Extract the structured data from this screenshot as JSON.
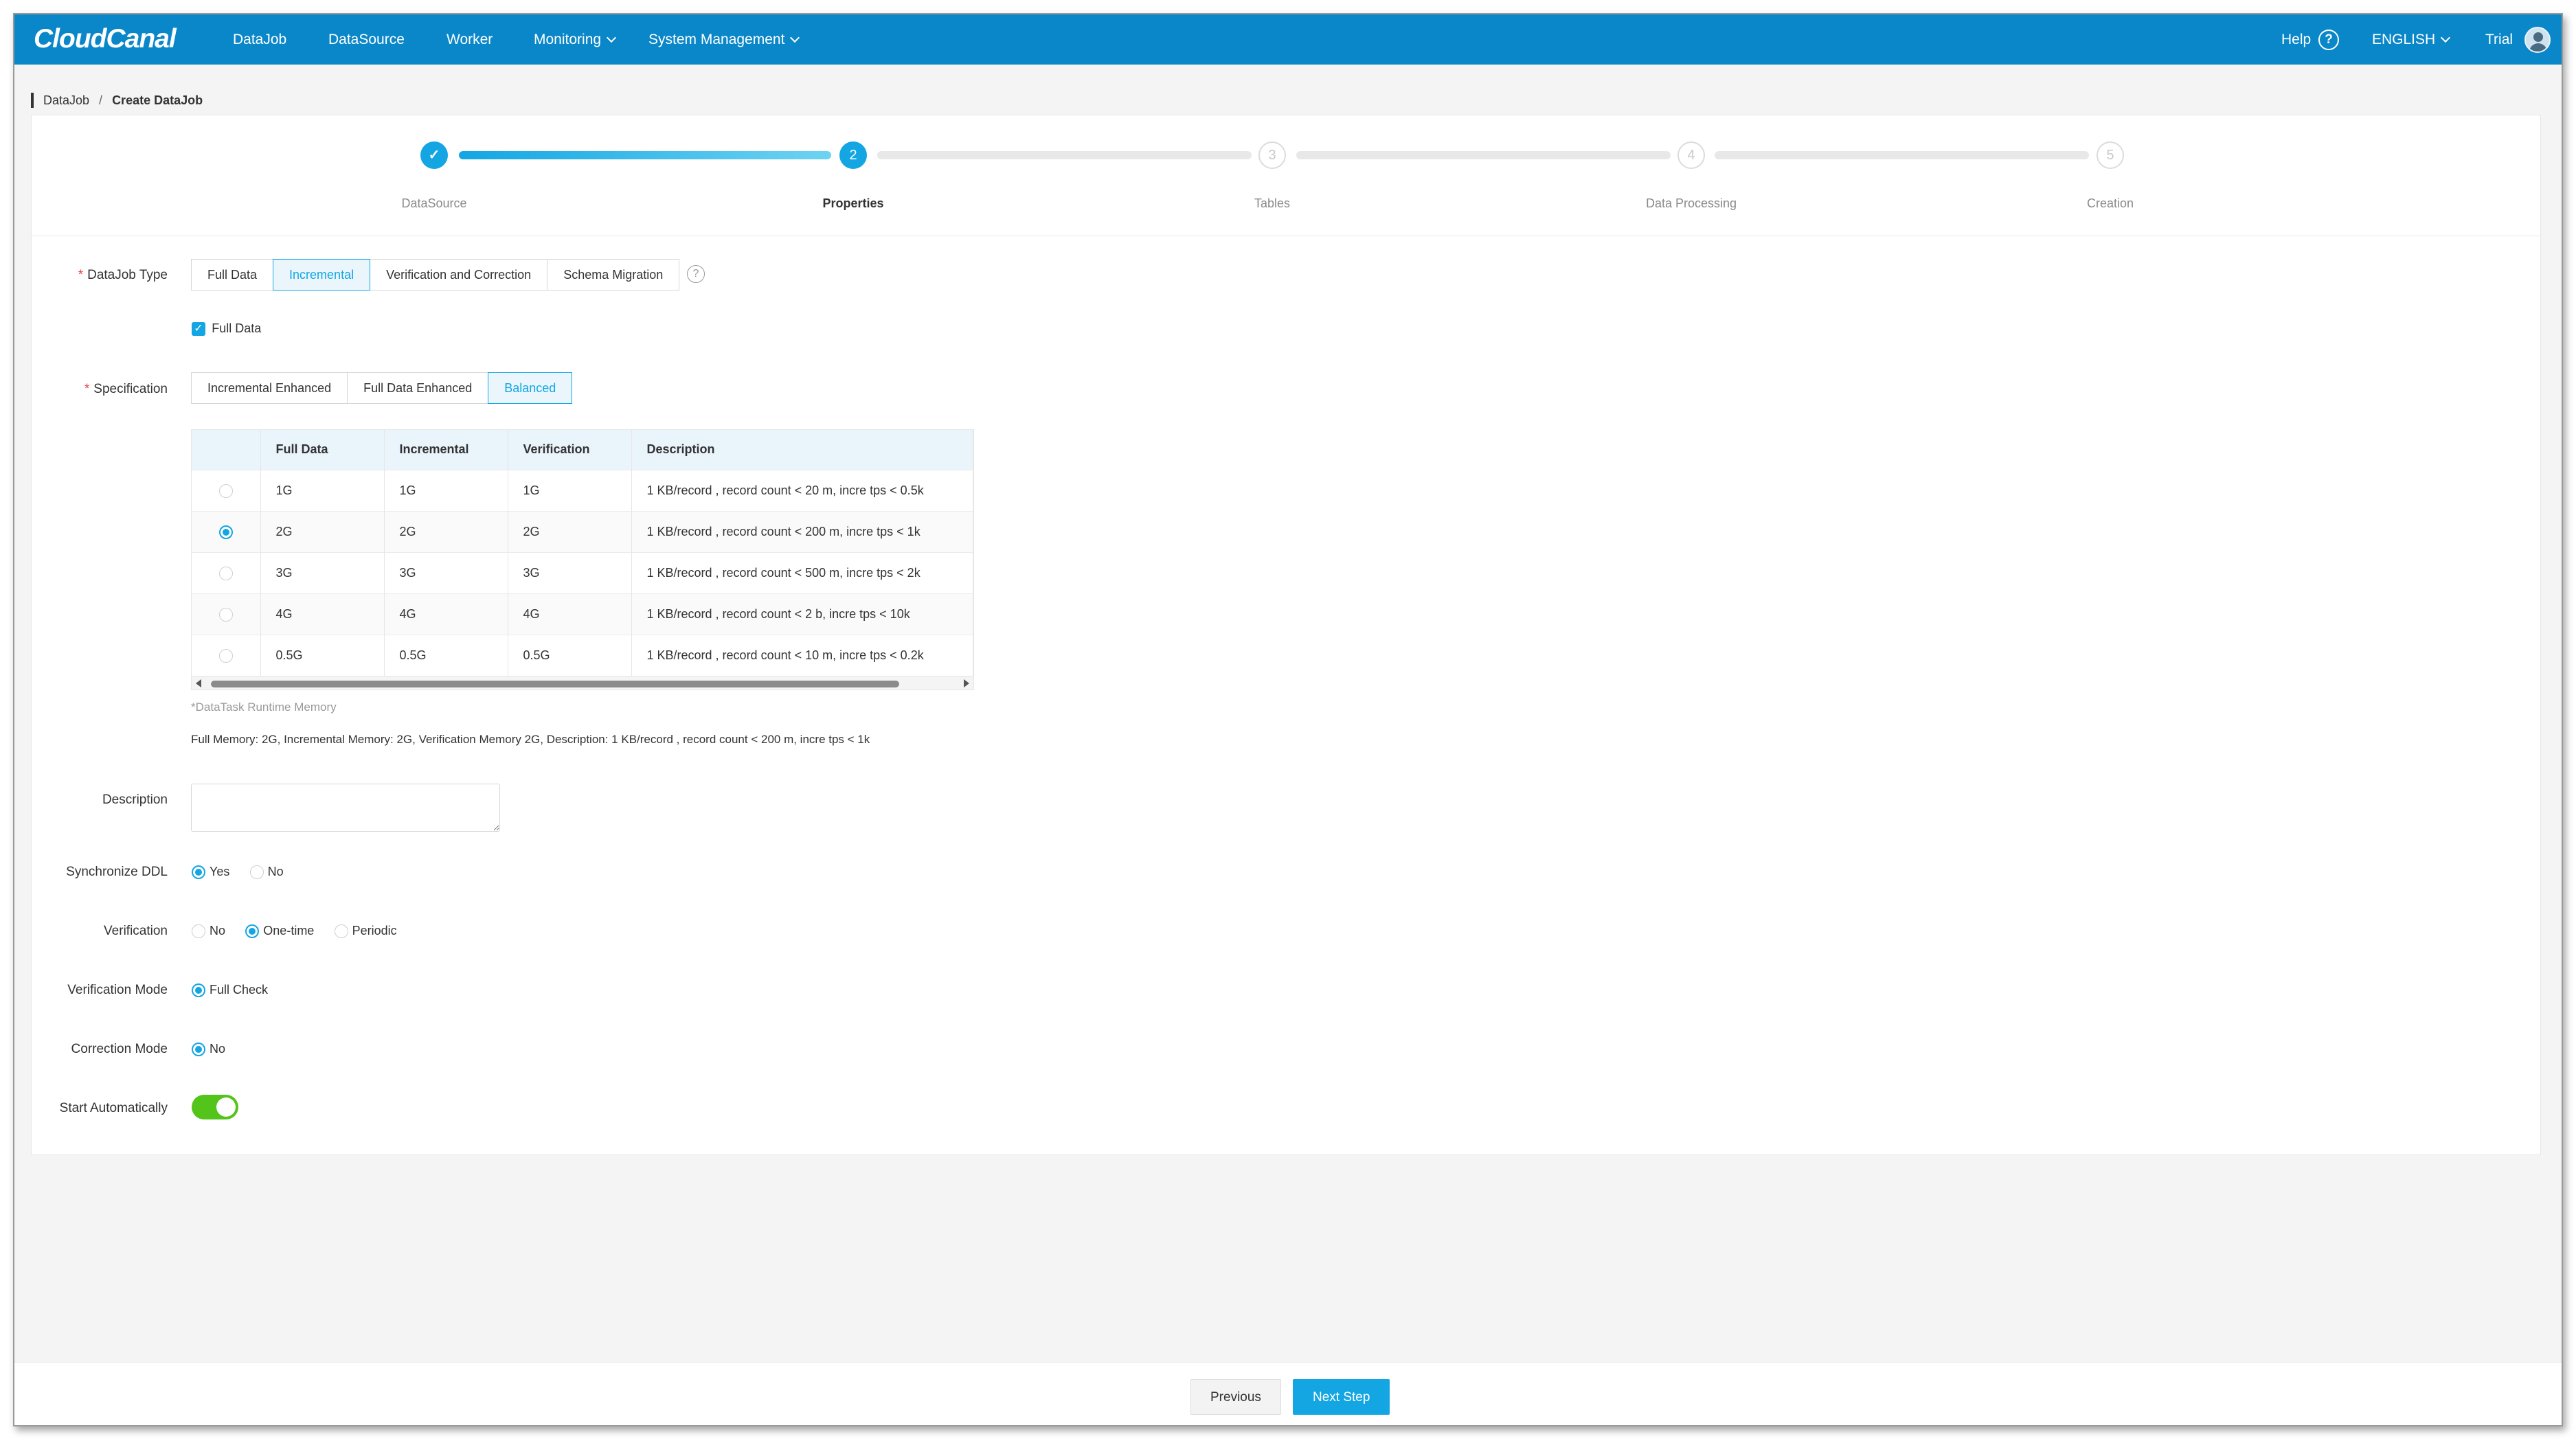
{
  "nav": {
    "logo": "CloudCanal",
    "items": [
      "DataJob",
      "DataSource",
      "Worker",
      "Monitoring",
      "System Management"
    ],
    "help": "Help",
    "help_icon": "?",
    "language": "ENGLISH",
    "user": "Trial"
  },
  "breadcrumb": {
    "parent": "DataJob",
    "separator": "/",
    "current": "Create DataJob"
  },
  "steps": [
    {
      "num": "✓",
      "label": "DataSource",
      "state": "done"
    },
    {
      "num": "2",
      "label": "Properties",
      "state": "active"
    },
    {
      "num": "3",
      "label": "Tables",
      "state": "todo"
    },
    {
      "num": "4",
      "label": "Data Processing",
      "state": "todo"
    },
    {
      "num": "5",
      "label": "Creation",
      "state": "todo"
    }
  ],
  "form": {
    "datajob_type": {
      "required_mark": "*",
      "label": "DataJob Type",
      "options": [
        "Full Data",
        "Incremental",
        "Verification and Correction",
        "Schema Migration"
      ],
      "selected": "Incremental",
      "info_icon": "?"
    },
    "full_data_checkbox": {
      "label": "Full Data",
      "checked": true
    },
    "specification": {
      "required_mark": "*",
      "label": "Specification",
      "options": [
        "Incremental Enhanced",
        "Full Data Enhanced",
        "Balanced"
      ],
      "selected": "Balanced",
      "table": {
        "columns": [
          "",
          "Full Data",
          "Incremental",
          "Verification",
          "Description"
        ],
        "rows": [
          {
            "full": "1G",
            "incr": "1G",
            "verif": "1G",
            "desc": "1 KB/record , record count < 20 m, incre tps < 0.5k",
            "selected": false
          },
          {
            "full": "2G",
            "incr": "2G",
            "verif": "2G",
            "desc": "1 KB/record , record count < 200 m, incre tps < 1k",
            "selected": true
          },
          {
            "full": "3G",
            "incr": "3G",
            "verif": "3G",
            "desc": "1 KB/record , record count < 500 m, incre tps < 2k",
            "selected": false
          },
          {
            "full": "4G",
            "incr": "4G",
            "verif": "4G",
            "desc": "1 KB/record , record count < 2 b, incre tps < 10k",
            "selected": false
          },
          {
            "full": "0.5G",
            "incr": "0.5G",
            "verif": "0.5G",
            "desc": "1 KB/record , record count < 10 m, incre tps < 0.2k",
            "selected": false
          }
        ]
      },
      "note": "*DataTask Runtime Memory",
      "summary": "Full Memory: 2G, Incremental Memory: 2G, Verification Memory 2G, Description: 1 KB/record , record count < 200 m, incre tps < 1k"
    },
    "description": {
      "label": "Description",
      "value": "",
      "placeholder": ""
    },
    "sync_ddl": {
      "label": "Synchronize DDL",
      "options": [
        "Yes",
        "No"
      ],
      "selected": "Yes"
    },
    "verification": {
      "label": "Verification",
      "options": [
        "No",
        "One-time",
        "Periodic"
      ],
      "selected": "One-time"
    },
    "verification_mode": {
      "label": "Verification Mode",
      "options": [
        "Full Check"
      ],
      "selected": "Full Check"
    },
    "correction_mode": {
      "label": "Correction Mode",
      "options": [
        "No"
      ],
      "selected": "No"
    },
    "start_auto": {
      "label": "Start Automatically",
      "on": true
    }
  },
  "footer": {
    "previous": "Previous",
    "next": "Next Step"
  },
  "colors": {
    "nav_bg": "#0a87c9",
    "accent": "#13a6e3",
    "toggle_on": "#52c41a",
    "required": "#e84545"
  }
}
